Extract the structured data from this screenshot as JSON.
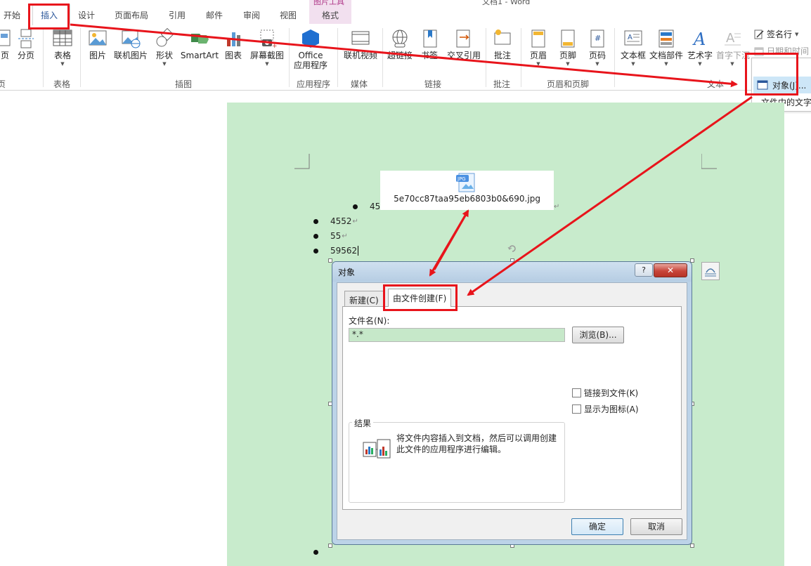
{
  "ribbon": {
    "tabs": [
      {
        "label": "开始"
      },
      {
        "label": "插入"
      },
      {
        "label": "设计"
      },
      {
        "label": "页面布局"
      },
      {
        "label": "引用"
      },
      {
        "label": "邮件"
      },
      {
        "label": "审阅"
      },
      {
        "label": "视图"
      },
      {
        "label": "格式"
      }
    ],
    "contextual_group_label": "图片工具",
    "window_title_fragment": "文档1 - Word",
    "buttons": {
      "page": "页",
      "page_break": "分页",
      "table": "表格",
      "picture": "图片",
      "online_picture": "联机图片",
      "shapes": "形状",
      "smartart": "SmartArt",
      "chart": "图表",
      "screenshot": "屏幕截图",
      "office_apps_line1": "Office",
      "office_apps_line2": "应用程序",
      "online_video": "联机视频",
      "hyperlink": "超链接",
      "bookmark": "书签",
      "cross_reference": "交叉引用",
      "comment": "批注",
      "header": "页眉",
      "footer": "页脚",
      "page_number": "页码",
      "text_box": "文本框",
      "quick_parts": "文档部件",
      "wordart": "艺术字",
      "drop_cap": "首字下沉",
      "signature_line": "签名行",
      "date_time": "日期和时间",
      "object": "对象"
    },
    "groups": {
      "pages": "页",
      "tables": "表格",
      "illustrations": "插图",
      "apps": "应用程序",
      "media": "媒体",
      "links": "链接",
      "comments": "批注",
      "header_footer": "页眉和页脚",
      "text": "文本"
    }
  },
  "object_dropdown": {
    "items": [
      "对象(J)...",
      "文件中的文字"
    ]
  },
  "document": {
    "file_chip_name": "5e70cc87taa95eb6803b0&690.jpg",
    "file_chip_badge": "JPG",
    "bullets": [
      "45",
      "4552",
      "55",
      "59562"
    ]
  },
  "dialog": {
    "title": "对象",
    "help": "?",
    "close": "✕",
    "tabs": [
      "新建(C)",
      "由文件创建(F)"
    ],
    "filename_label": "文件名(N):",
    "filename_value": "*.*",
    "browse": "浏览(B)...",
    "link_to_file": "链接到文件(K)",
    "display_as_icon": "显示为图标(A)",
    "result_legend": "结果",
    "result_text": "将文件内容插入到文档，然后可以调用创建此文件的应用程序进行编辑。",
    "ok": "确定",
    "cancel": "取消"
  },
  "colors": {
    "annotation_red": "#e8141b",
    "page_green": "#c8ebcc",
    "accent_blue": "#2b579a"
  }
}
